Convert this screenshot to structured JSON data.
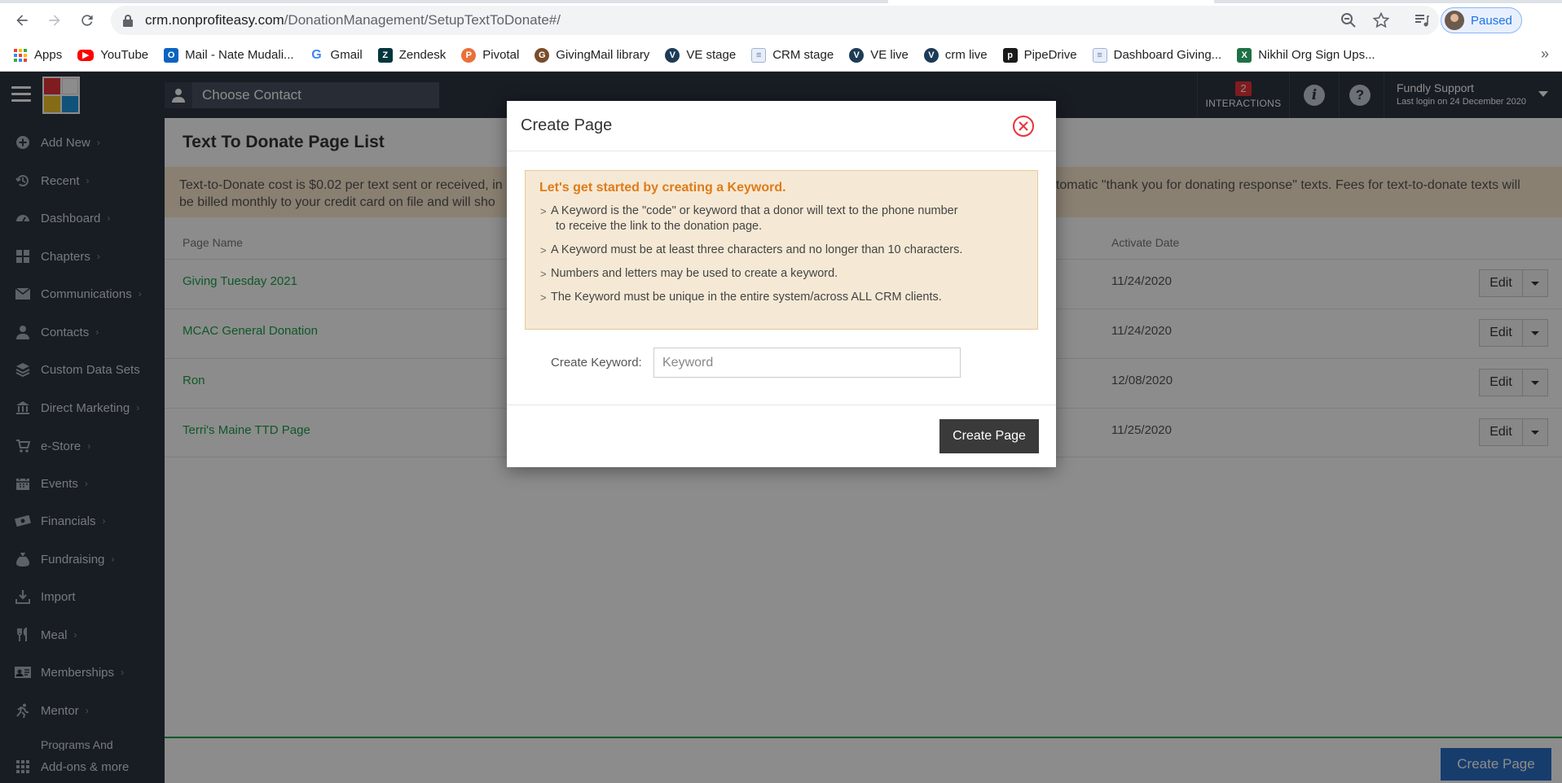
{
  "browser": {
    "url_host": "crm.nonprofiteasy.com",
    "url_path": "/DonationManagement/SetupTextToDonate#/",
    "profile_status": "Paused",
    "bookmarks": [
      {
        "label": "Apps",
        "icon": "apps-grid-icon"
      },
      {
        "label": "YouTube",
        "icon": "youtube-icon"
      },
      {
        "label": "Mail - Nate Mudali...",
        "icon": "outlook-icon"
      },
      {
        "label": "Gmail",
        "icon": "google-icon"
      },
      {
        "label": "Zendesk",
        "icon": "zendesk-icon"
      },
      {
        "label": "Pivotal",
        "icon": "pivotal-icon"
      },
      {
        "label": "GivingMail library",
        "icon": "givingmail-icon"
      },
      {
        "label": "VE stage",
        "icon": "ve-icon"
      },
      {
        "label": "CRM stage",
        "icon": "page-icon"
      },
      {
        "label": "VE live",
        "icon": "ve-icon"
      },
      {
        "label": "crm live",
        "icon": "ve-icon"
      },
      {
        "label": "PipeDrive",
        "icon": "pipedrive-icon"
      },
      {
        "label": "Dashboard Giving...",
        "icon": "page-icon"
      },
      {
        "label": "Nikhil Org Sign Ups...",
        "icon": "excel-icon"
      }
    ],
    "more_bookmarks": "»"
  },
  "header": {
    "choose_contact": "Choose Contact",
    "interactions_count": "2",
    "interactions_label": "INTERACTIONS",
    "user_name": "Fundly Support",
    "last_login": "Last login on 24 December 2020"
  },
  "sidebar": {
    "items": [
      {
        "label": "Add New",
        "icon": "plus-circle-icon",
        "chevron": true
      },
      {
        "label": "Recent",
        "icon": "history-icon",
        "chevron": true
      },
      {
        "label": "Dashboard",
        "icon": "dashboard-icon",
        "chevron": true
      },
      {
        "label": "Chapters",
        "icon": "grid-icon",
        "chevron": true
      },
      {
        "label": "Communications",
        "icon": "envelope-icon",
        "chevron": true
      },
      {
        "label": "Contacts",
        "icon": "user-icon",
        "chevron": true
      },
      {
        "label": "Custom Data Sets",
        "icon": "database-icon",
        "chevron": false
      },
      {
        "label": "Direct Marketing",
        "icon": "bank-icon",
        "chevron": true
      },
      {
        "label": "e-Store",
        "icon": "cart-icon",
        "chevron": true
      },
      {
        "label": "Events",
        "icon": "calendar-icon",
        "chevron": true
      },
      {
        "label": "Financials",
        "icon": "money-icon",
        "chevron": true
      },
      {
        "label": "Fundraising",
        "icon": "money-bag-icon",
        "chevron": true
      },
      {
        "label": "Import",
        "icon": "download-icon",
        "chevron": false
      },
      {
        "label": "Meal",
        "icon": "utensils-icon",
        "chevron": true
      },
      {
        "label": "Memberships",
        "icon": "id-card-icon",
        "chevron": true
      },
      {
        "label": "Mentor",
        "icon": "running-icon",
        "chevron": true
      }
    ],
    "partial_item": "Programs And",
    "bottom_item": "Add-ons & more"
  },
  "main": {
    "title": "Text To Donate Page List",
    "notice_left": "Text-to-Donate cost is $0.02 per text sent or received, in",
    "notice_left_2": "be billed monthly to your credit card on file and will sho",
    "notice_right": "utomatic \"thank you for donating response\" texts. Fees for text-to-donate texts will",
    "col_page_name": "Page Name",
    "col_activate_date": "Activate Date",
    "rows": [
      {
        "name": "Giving Tuesday 2021",
        "date": "11/24/2020",
        "edit": "Edit"
      },
      {
        "name": "MCAC General Donation",
        "date": "11/24/2020",
        "edit": "Edit"
      },
      {
        "name": "Ron",
        "date": "12/08/2020",
        "edit": "Edit"
      },
      {
        "name": "Terri's Maine TTD Page",
        "date": "11/25/2020",
        "edit": "Edit"
      }
    ],
    "footer_button": "Create Page"
  },
  "modal": {
    "title": "Create Page",
    "info_title": "Let's get started by creating a Keyword.",
    "info_items": [
      "A Keyword is the \"code\" or keyword that a donor will text to the phone number",
      "A Keyword must be at least three characters and no longer than 10 characters.",
      "Numbers and letters may be used to create a keyword.",
      "The Keyword must be unique in the entire system/across ALL CRM clients."
    ],
    "info_item_1_cont": "to receive the link to the donation page.",
    "keyword_label": "Create Keyword:",
    "keyword_placeholder": "Keyword",
    "keyword_value": "",
    "create_button": "Create Page"
  },
  "colors": {
    "header_bg": "#2d3440",
    "accent_green": "#1aa14a",
    "info_orange": "#e07b18",
    "footer_blue": "#2b6fc6",
    "close_red": "#e8343a"
  }
}
